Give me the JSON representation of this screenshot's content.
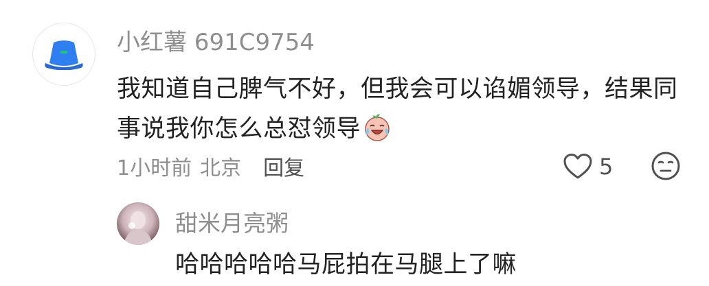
{
  "comment": {
    "username": "小红薯 691C9754",
    "text": "我知道自己脾气不好，但我会可以谄媚领导，结果同事说我你怎么总怼领导",
    "emoji": "crying-laughing-emoji",
    "time": "1小时前",
    "location": "北京",
    "reply_label": "回复",
    "like_count": "5"
  },
  "sub_reply": {
    "username": "甜米月亮粥",
    "text": "哈哈哈哈哈马屁拍在马腿上了嘛"
  },
  "colors": {
    "avatar_hat": "#2f7ff0",
    "avatar_band": "#1fc77a",
    "meta_gray": "#8e8e8e",
    "text_dark": "#222222"
  }
}
